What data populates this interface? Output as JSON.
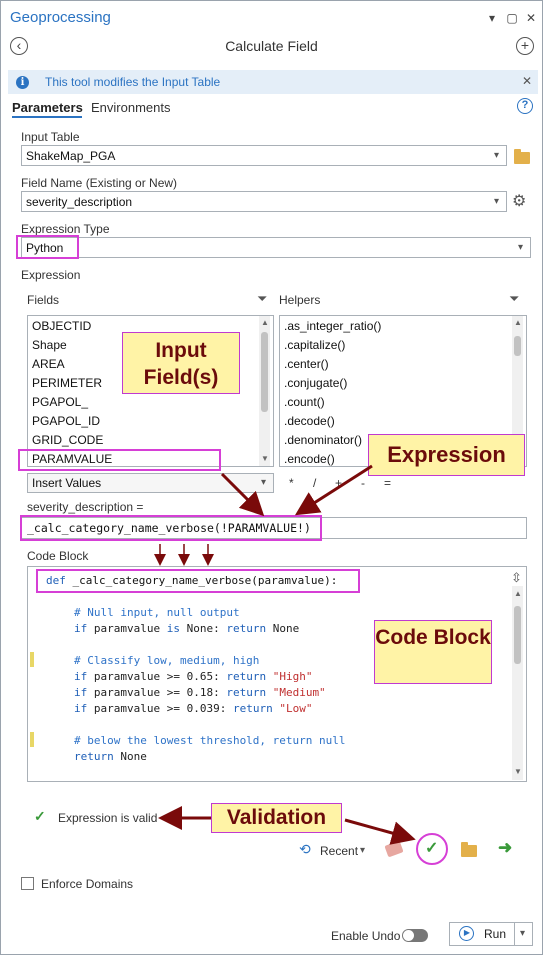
{
  "pane": {
    "title": "Geoprocessing",
    "controls": {
      "pin": "▾",
      "maximize": "▢",
      "close": "✕"
    }
  },
  "header": {
    "title": "Calculate Field",
    "back_icon": "back-arrow-icon",
    "add_icon": "plus-icon"
  },
  "info_bar": {
    "text": "This tool modifies the Input Table",
    "icon": "i"
  },
  "tabs": [
    {
      "label": "Parameters",
      "active": true
    },
    {
      "label": "Environments",
      "active": false
    }
  ],
  "params": {
    "input_table": {
      "label": "Input Table",
      "value": "ShakeMap_PGA"
    },
    "field_name": {
      "label": "Field Name (Existing or New)",
      "value": "severity_description"
    },
    "expression_type": {
      "label": "Expression Type",
      "value": "Python"
    },
    "expression_label": "Expression",
    "fields_label": "Fields",
    "helpers_label": "Helpers",
    "fields": [
      "OBJECTID",
      "Shape",
      "AREA",
      "PERIMETER",
      "PGAPOL_",
      "PGAPOL_ID",
      "GRID_CODE",
      "PARAMVALUE"
    ],
    "helpers": [
      ".as_integer_ratio()",
      ".capitalize()",
      ".center()",
      ".conjugate()",
      ".count()",
      ".decode()",
      ".denominator()",
      ".encode()"
    ],
    "insert_values": "Insert Values",
    "operators": [
      "*",
      "/",
      "+",
      "-",
      "="
    ],
    "expression_field_label": "severity_description =",
    "expression_value": "_calc_category_name_verbose(!PARAMVALUE!)",
    "code_block_label": "Code Block"
  },
  "code_block": {
    "line1_def": "def",
    "line1_rest": " _calc_category_name_verbose(paramvalue):",
    "lines": {
      "c1": "# Null input, null output",
      "l2a": "if",
      "l2b": " paramvalue ",
      "l2c": "is",
      "l2d": " None: ",
      "l2e": "return",
      "l2f": " None",
      "c2": "# Classify low, medium, high",
      "l3a": "if",
      "l3b": " paramvalue >= 0.65: ",
      "l3c": "return",
      "l3d": "\"High\"",
      "l4a": "if",
      "l4b": " paramvalue >= 0.18: ",
      "l4c": "return",
      "l4d": "\"Medium\"",
      "l5a": "if",
      "l5b": " paramvalue >= 0.039: ",
      "l5c": "return",
      "l5d": "\"Low\"",
      "c3": "# below the lowest threshold, return null",
      "l6a": "return",
      "l6b": " None"
    }
  },
  "callouts": {
    "input_fields": "Input Field(s)",
    "expression": "Expression",
    "code_block": "Code Block",
    "validation": "Validation"
  },
  "validation": {
    "text": "Expression is valid"
  },
  "toolbar": {
    "recent_label": "Recent"
  },
  "enforce_domains": {
    "label": "Enforce Domains",
    "checked": false
  },
  "footer": {
    "enable_undo": "Enable Undo",
    "run_label": "Run"
  },
  "colors": {
    "accent": "#2b73c2",
    "highlight": "#d63fd6",
    "callout_bg": "#fff3a6",
    "arrow": "#7a0a0a"
  }
}
